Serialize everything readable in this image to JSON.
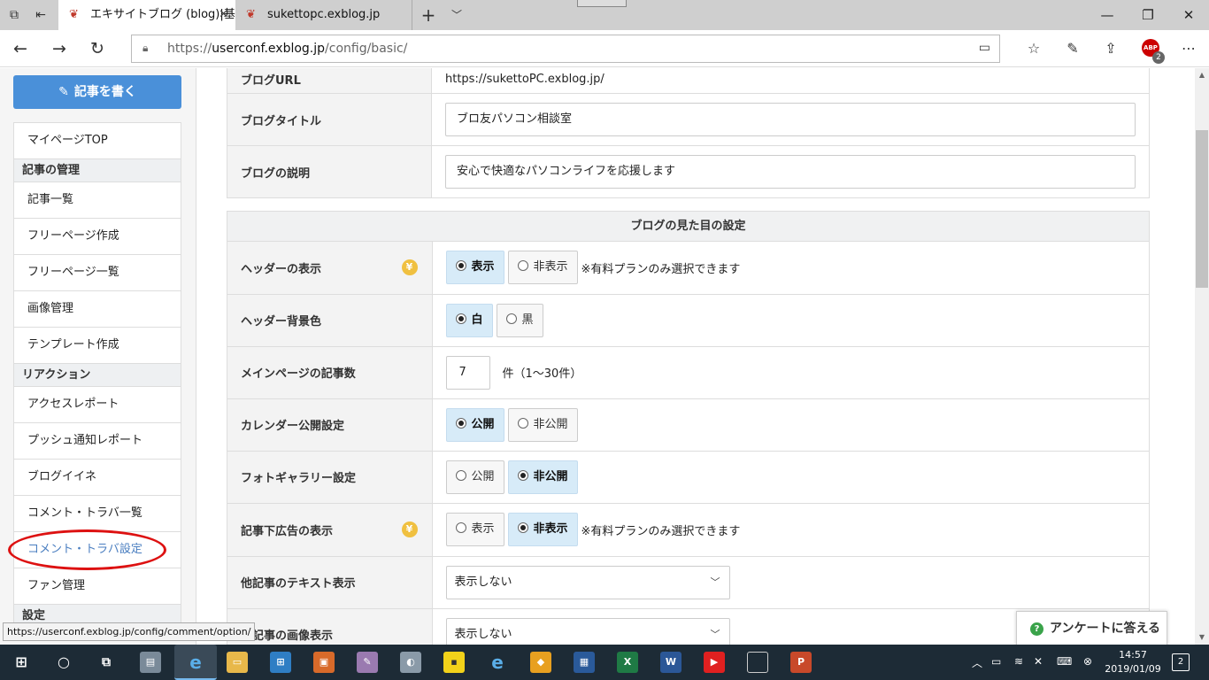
{
  "browser": {
    "tabs": [
      {
        "title": "エキサイトブログ (blog)|基本",
        "active": true
      },
      {
        "title": "sukettopc.exblog.jp",
        "active": false
      }
    ],
    "url_prefix": "https://",
    "url_domain": "userconf.exblog.jp",
    "url_path": "/config/basic/",
    "adblock_label": "ABP",
    "adblock_count": "2"
  },
  "sidebar": {
    "write_button": "記事を書く",
    "items": [
      {
        "label": "マイページTOP",
        "type": "item"
      },
      {
        "label": "記事の管理",
        "type": "header"
      },
      {
        "label": "記事一覧",
        "type": "item"
      },
      {
        "label": "フリーページ作成",
        "type": "item"
      },
      {
        "label": "フリーページ一覧",
        "type": "item"
      },
      {
        "label": "画像管理",
        "type": "item"
      },
      {
        "label": "テンプレート作成",
        "type": "item"
      },
      {
        "label": "リアクション",
        "type": "header"
      },
      {
        "label": "アクセスレポート",
        "type": "item"
      },
      {
        "label": "プッシュ通知レポート",
        "type": "item"
      },
      {
        "label": "ブログイイネ",
        "type": "item"
      },
      {
        "label": "コメント・トラバ一覧",
        "type": "item"
      },
      {
        "label": "コメント・トラバ設定",
        "type": "item",
        "highlighted": true
      },
      {
        "label": "ファン管理",
        "type": "item"
      },
      {
        "label": "設定",
        "type": "header"
      }
    ]
  },
  "basic": {
    "blog_url_label": "ブログURL",
    "blog_url_value": "https://sukettoPC.exblog.jp/",
    "blog_title_label": "ブログタイトル",
    "blog_title_value": "ブロ友パソコン相談室",
    "blog_desc_label": "ブログの説明",
    "blog_desc_value": "安心で快適なパソコンライフを応援します"
  },
  "appearance": {
    "section_title": "ブログの見た目の設定",
    "header_display": {
      "label": "ヘッダーの表示",
      "opt1": "表示",
      "opt2": "非表示",
      "selected": "表示",
      "note": "※有料プランのみ選択できます"
    },
    "header_bg": {
      "label": "ヘッダー背景色",
      "opt1": "白",
      "opt2": "黒",
      "selected": "白"
    },
    "posts_per_page": {
      "label": "メインページの記事数",
      "value": "7",
      "unit": "件（1〜30件）"
    },
    "calendar": {
      "label": "カレンダー公開設定",
      "opt1": "公開",
      "opt2": "非公開",
      "selected": "公開"
    },
    "photo_gallery": {
      "label": "フォトギャラリー設定",
      "opt1": "公開",
      "opt2": "非公開",
      "selected": "非公開"
    },
    "ad_display": {
      "label": "記事下広告の表示",
      "opt1": "表示",
      "opt2": "非表示",
      "selected": "非表示",
      "note": "※有料プランのみ選択できます"
    },
    "other_text": {
      "label": "他記事のテキスト表示",
      "value": "表示しない"
    },
    "other_image": {
      "label": "他記事の画像表示",
      "value": "表示しない"
    }
  },
  "survey_button": "アンケートに答える",
  "status_url": "https://userconf.exblog.jp/config/comment/option/",
  "clock": {
    "time": "14:57",
    "date": "2019/01/09"
  },
  "notification_count": "2",
  "colors": {
    "accent_button": "#4a90d9",
    "selected_option": "#d7ebf8",
    "annotation_circle": "#dd1111",
    "premium_icon": "#f0c040"
  }
}
